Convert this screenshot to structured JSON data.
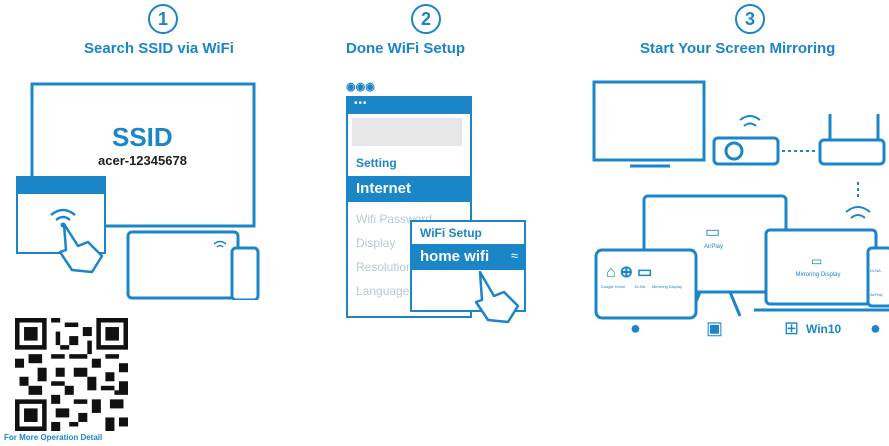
{
  "steps": [
    {
      "number": "1",
      "title": "Search SSID via WiFi"
    },
    {
      "number": "2",
      "title": "Done WiFi Setup"
    },
    {
      "number": "3",
      "title": "Start Your Screen Mirroring"
    }
  ],
  "step1": {
    "ssid_label": "SSID",
    "ssid_value": "acer-12345678"
  },
  "step2": {
    "menu_header": "Setting",
    "menu_selected": "Internet",
    "menu_items": [
      "Wifi Password",
      "Display",
      "Resolution",
      "Language"
    ],
    "popup_title": "WiFi Setup",
    "popup_value": "home wifi"
  },
  "step3": {
    "airplay_label": "AirPlay",
    "mirroring_label": "Mirroring Display",
    "tablet_labels": [
      "Google Home",
      "DLNA",
      "Mirroring Display"
    ],
    "phone_labels": [
      "DLNA",
      "AirPlay"
    ],
    "os_labels": [
      "",
      "",
      "Win10",
      ""
    ]
  },
  "qr": {
    "caption": "For More Operation Detail"
  },
  "colors": {
    "accent": "#1a86c8",
    "light_text": "#b9c9d6"
  },
  "icons": [
    "wifi-icon",
    "hand-pointer-icon",
    "airplay-icon",
    "cast-icon",
    "android-icon",
    "finder-icon",
    "windows-icon",
    "apple-icon",
    "qr-code"
  ]
}
